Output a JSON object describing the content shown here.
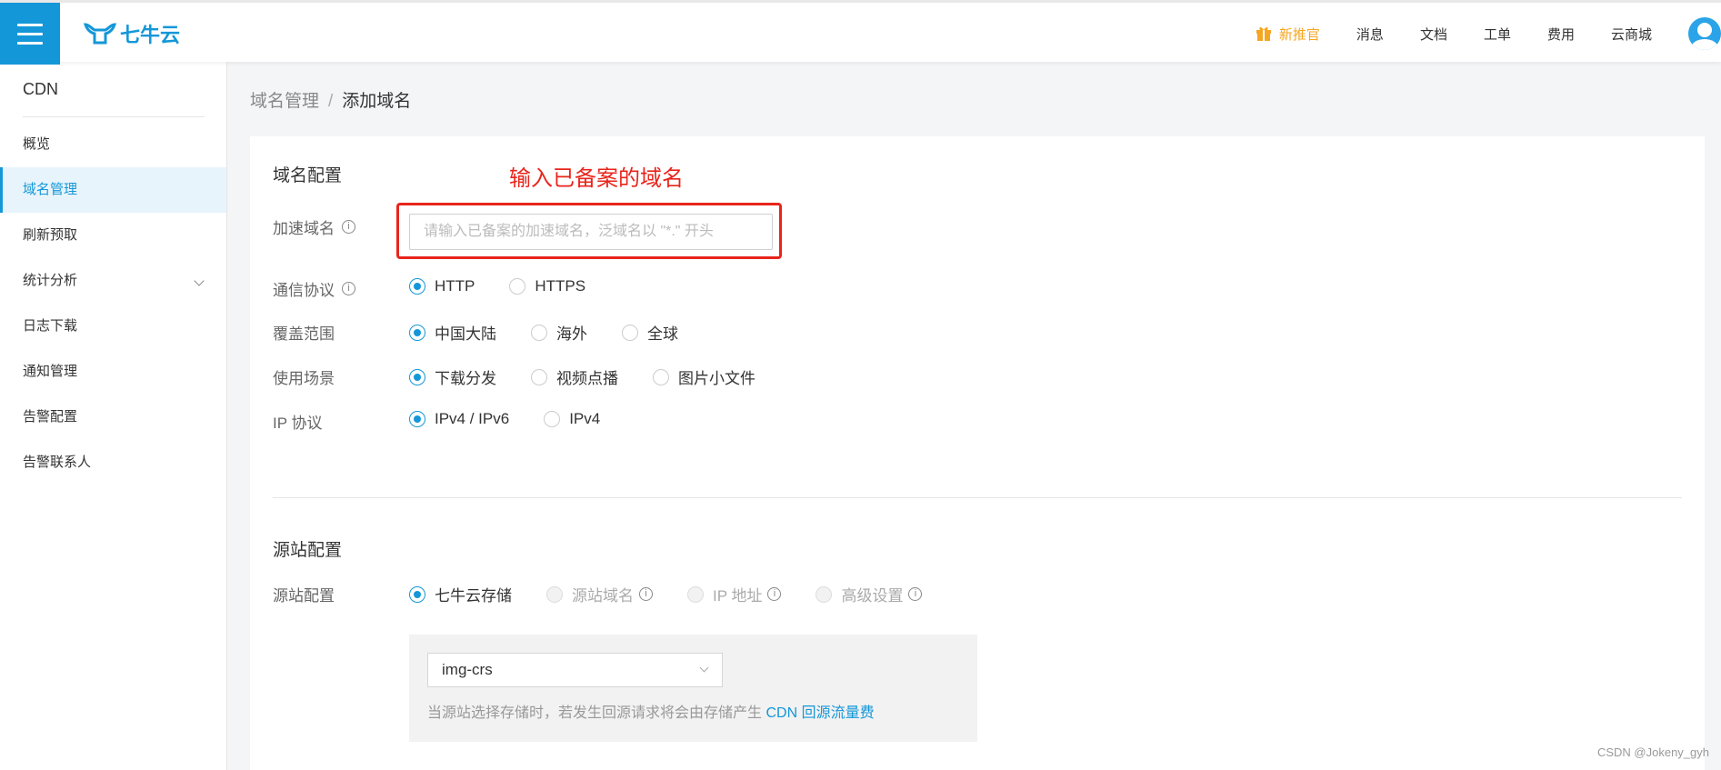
{
  "header": {
    "logo_text": "七牛云",
    "nav": [
      {
        "label": "新推官",
        "icon": "gift-icon",
        "highlight": true
      },
      {
        "label": "消息"
      },
      {
        "label": "文档"
      },
      {
        "label": "工单"
      },
      {
        "label": "费用"
      },
      {
        "label": "云商城"
      }
    ],
    "accent": "#1497d8"
  },
  "sidebar": {
    "product": "CDN",
    "items": [
      {
        "label": "概览"
      },
      {
        "label": "域名管理",
        "active": true
      },
      {
        "label": "刷新预取"
      },
      {
        "label": "统计分析",
        "expandable": true
      },
      {
        "label": "日志下载"
      },
      {
        "label": "通知管理"
      },
      {
        "label": "告警配置"
      },
      {
        "label": "告警联系人"
      }
    ]
  },
  "breadcrumb": {
    "parent": "域名管理",
    "separator": "/",
    "current": "添加域名"
  },
  "domain_section": {
    "title": "域名配置",
    "annotation": "输入已备案的域名",
    "domain_label": "加速域名",
    "domain_value": "",
    "domain_placeholder": "请输入已备案的加速域名，泛域名以 \"*.\" 开头",
    "protocol": {
      "label": "通信协议",
      "options": [
        "HTTP",
        "HTTPS"
      ],
      "selected": "HTTP"
    },
    "coverage": {
      "label": "覆盖范围",
      "options": [
        "中国大陆",
        "海外",
        "全球"
      ],
      "selected": "中国大陆"
    },
    "scenario": {
      "label": "使用场景",
      "options": [
        "下载分发",
        "视频点播",
        "图片小文件"
      ],
      "selected": "下载分发"
    },
    "ip_protocol": {
      "label": "IP 协议",
      "options": [
        "IPv4 / IPv6",
        "IPv4"
      ],
      "selected": "IPv4 / IPv6"
    }
  },
  "origin_section": {
    "title": "源站配置",
    "label": "源站配置",
    "options": [
      "七牛云存储",
      "源站域名",
      "IP 地址",
      "高级设置"
    ],
    "selected": "七牛云存储",
    "bucket": "img-crs",
    "hint_prefix": "当源站选择存储时，若发生回源请求将会由存储产生 ",
    "hint_link": "CDN 回源流量费"
  },
  "watermark": "CSDN @Jokeny_gyh"
}
